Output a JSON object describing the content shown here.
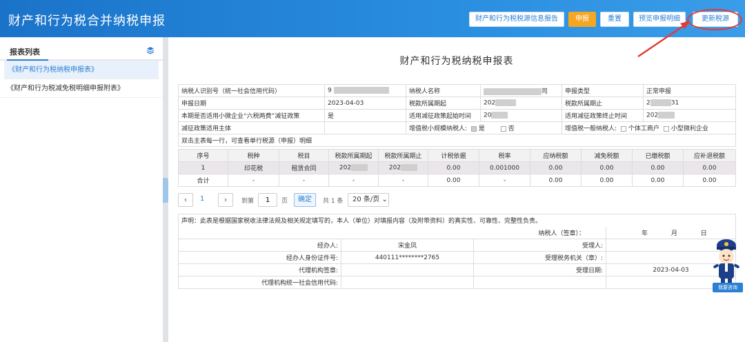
{
  "header": {
    "title": "财产和行为税合并纳税申报",
    "buttons": {
      "source_report": "财产和行为税税源信息报告",
      "declare": "申报",
      "reset": "重置",
      "preview": "预览申报明细",
      "update_source": "更新税源"
    }
  },
  "sidebar": {
    "title": "报表列表",
    "items": [
      {
        "label": "《财产和行为税纳税申报表》"
      },
      {
        "label": "《财产和行为税减免税明细申报附表》"
      }
    ]
  },
  "form": {
    "title": "财产和行为税纳税申报表",
    "info": {
      "taxpayer_id_label": "纳税人识别号（统一社会信用代码）",
      "taxpayer_id_prefix": "9",
      "taxpayer_name_label": "纳税人名称",
      "taxpayer_name_suffix": "司",
      "declare_type_label": "申报类型",
      "declare_type_value": "正常申报",
      "declare_date_label": "申报日期",
      "declare_date_value": "2023-04-03",
      "period_start_label": "税款所属期起",
      "period_start_value": "202",
      "period_end_label": "税款所属期止",
      "period_end_prefix": "2",
      "period_end_suffix": "31",
      "small_policy_label": "本期是否适用小微企业“六税两费”减征政策",
      "small_policy_value": "是",
      "reduce_start_label": "适用减征政策起始时间",
      "reduce_start_value": "20",
      "reduce_end_label": "适用减征政策终止时间",
      "reduce_end_value": "202",
      "reduce_subject_label": "减征政策适用主体",
      "small_vat_label": "增值税小规模纳税人:",
      "yes_label": "是",
      "no_label": "否",
      "general_vat_label": "增值税一般纳税人:",
      "individual_label": "个体工商户",
      "micro_label": "小型微利企业",
      "hint": "双击主表每一行，可查看单行税源（申报）明细"
    },
    "detail": {
      "headers": [
        "序号",
        "税种",
        "税目",
        "税款所属期起",
        "税款所属期止",
        "计税依据",
        "税率",
        "应纳税额",
        "减免税额",
        "已缴税额",
        "应补退税额"
      ],
      "rows": [
        [
          "1",
          "印花税",
          "租赁合同",
          "202",
          "202",
          "0.00",
          "0.001000",
          "0.00",
          "0.00",
          "0.00",
          "0.00"
        ],
        [
          "合计",
          "-",
          "-",
          "-",
          "-",
          "0.00",
          "-",
          "0.00",
          "0.00",
          "0.00",
          "0.00"
        ]
      ]
    },
    "pager": {
      "current": "1",
      "goto_label": "到第",
      "goto_value": "1",
      "page_label": "页",
      "confirm": "确定",
      "total": "共 1 条",
      "page_size": "20 条/页"
    },
    "declaration": {
      "statement": "声明：此表是根据国家税收法律法规及相关规定填写的，本人（单位）对填报内容（及附带资料）的真实性、可靠性、完整性负责。",
      "taxpayer_sign": "纳税人（签章）：",
      "year": "年",
      "month": "月",
      "day": "日",
      "handler_label": "经办人:",
      "handler_value": "宋金凤",
      "receiver_label": "受理人:",
      "handler_id_label": "经办人身份证件号:",
      "handler_id_value": "440111********2765",
      "tax_office_label": "受理税务机关（章）:",
      "agency_label": "代理机构签章:",
      "accept_date_label": "受理日期:",
      "accept_date_value": "2023-04-03",
      "agency_code_label": "代理机构统一社会信用代码:"
    }
  },
  "assistant": {
    "label": "我要咨询"
  },
  "colors": {
    "header": "#1a73c9",
    "accent": "#2b7fd4",
    "orange": "#f5a623",
    "annotation_red": "#e53935"
  }
}
